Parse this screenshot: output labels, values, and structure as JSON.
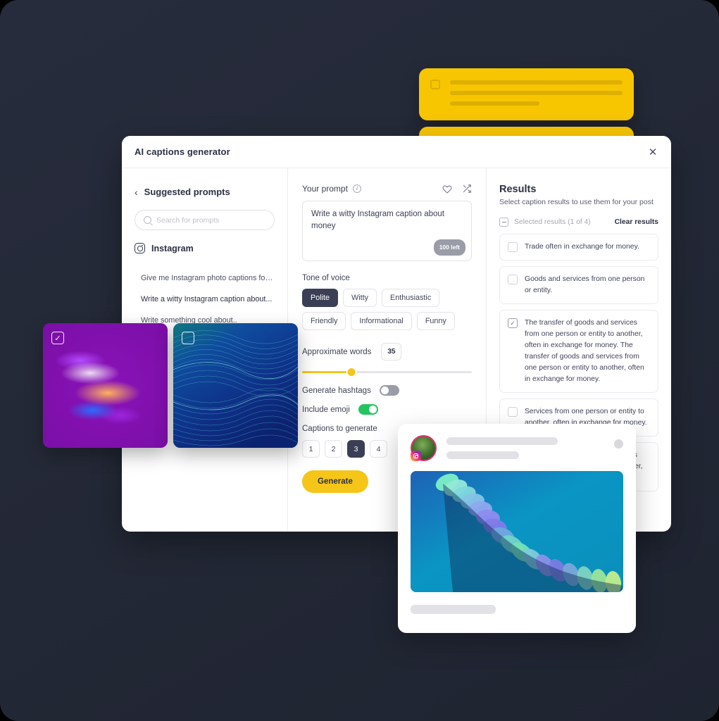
{
  "dialog": {
    "title": "AI captions generator",
    "close_label": "✕"
  },
  "sidebar": {
    "back_icon": "‹",
    "heading": "Suggested prompts",
    "search": {
      "placeholder": "Search for prompts",
      "value": ""
    },
    "platform": "Instagram",
    "prompts": [
      {
        "label": "Give me Instagram photo captions for a..."
      },
      {
        "label": "Write a witty Instagram caption about..."
      },
      {
        "label": "Write something cool about.."
      }
    ]
  },
  "prompt_panel": {
    "label": "Your prompt",
    "info_glyph": "i",
    "text": "Write a witty Instagram caption about money",
    "chars_left": "100 left",
    "tone_label": "Tone of voice",
    "tones": [
      "Polite",
      "Witty",
      "Enthusiastic",
      "Friendly",
      "Informational",
      "Funny"
    ],
    "tone_selected": "Polite",
    "words_label": "Approximate words",
    "words_value": "35",
    "slider_percent": 29,
    "hashtags_label": "Generate hashtags",
    "hashtags_on": false,
    "emoji_label": "Include emoji",
    "emoji_on": true,
    "captions_label": "Captions to generate",
    "caption_counts": [
      "1",
      "2",
      "3",
      "4"
    ],
    "caption_count_selected": "3",
    "generate_label": "Generate"
  },
  "results": {
    "title": "Results",
    "subtitle": "Select caption results to use them for your post",
    "selected_summary": "Selected results (1 of 4)",
    "clear_label": "Clear results",
    "check_glyph": "✓",
    "items": [
      {
        "text": "Trade often in exchange for money.",
        "checked": false
      },
      {
        "text": "Goods and services from one person or entity.",
        "checked": false
      },
      {
        "text": "The transfer of goods and services from one person or entity to another, often in exchange for money. The transfer of goods and services from one person or entity to another, often in exchange for money.",
        "checked": true
      },
      {
        "text": "Services from one person or entity to another, often in exchange for money.",
        "checked": false
      },
      {
        "text": "The transfer of goods and services from one person or entity to another, often in",
        "checked": false
      }
    ]
  },
  "thumbnails": [
    {
      "name": "gradient-blob-image",
      "selected": true,
      "check_glyph": "✓"
    },
    {
      "name": "blue-waves-image",
      "selected": false,
      "check_glyph": ""
    }
  ],
  "colors": {
    "accent_yellow": "#F5C518",
    "dark_navy": "#3b3f55",
    "toggle_green": "#22C55E",
    "page_background": "#232838"
  }
}
